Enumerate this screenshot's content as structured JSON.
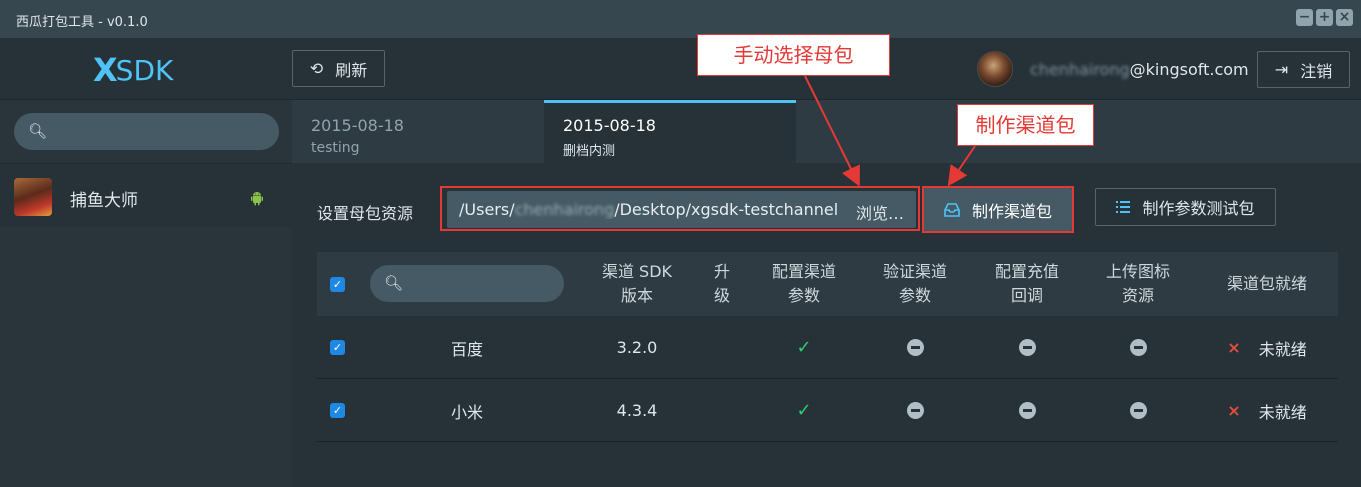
{
  "window": {
    "title": "西瓜打包工具 - v0.1.0",
    "controls": [
      "−",
      "+",
      "×"
    ]
  },
  "header": {
    "logo_x": "X",
    "logo_sdk": "SDK",
    "refresh_label": "刷新",
    "user_blurred": "chenhairong",
    "user_domain": "@kingsoft.com",
    "logout_label": "注销"
  },
  "sidebar": {
    "search_placeholder": "",
    "items": [
      {
        "label": "捕鱼大师",
        "platform": "android"
      }
    ]
  },
  "tabs": [
    {
      "date": "2015-08-18",
      "name": "testing",
      "active": false
    },
    {
      "date": "2015-08-18",
      "name": "删档内测",
      "active": true
    }
  ],
  "source": {
    "label": "设置母包资源",
    "path_prefix": "/Users/",
    "path_blurred": "chenhairong",
    "path_suffix": "/Desktop/xgsdk-testchannel.a",
    "browse_label": "浏览…",
    "make_button": "制作渠道包",
    "param_button": "制作参数测试包"
  },
  "table": {
    "headers": {
      "version": "渠道 SDK\n版本",
      "upgrade": "升\n级",
      "config": "配置渠道\n参数",
      "verify": "验证渠道\n参数",
      "recharge": "配置充值\n回调",
      "icon": "上传图标\n资源",
      "ready": "渠道包就绪"
    },
    "rows": [
      {
        "name": "百度",
        "version": "3.2.0",
        "config_ok": true,
        "status": "未就绪"
      },
      {
        "name": "小米",
        "version": "4.3.4",
        "config_ok": true,
        "status": "未就绪"
      }
    ]
  },
  "annotations": {
    "select_parent": "手动选择母包",
    "make_channel": "制作渠道包"
  },
  "colors": {
    "accent": "#4fc3f7",
    "ok": "#2ecc71",
    "error": "#e74c3c",
    "annotation": "#e53935"
  }
}
